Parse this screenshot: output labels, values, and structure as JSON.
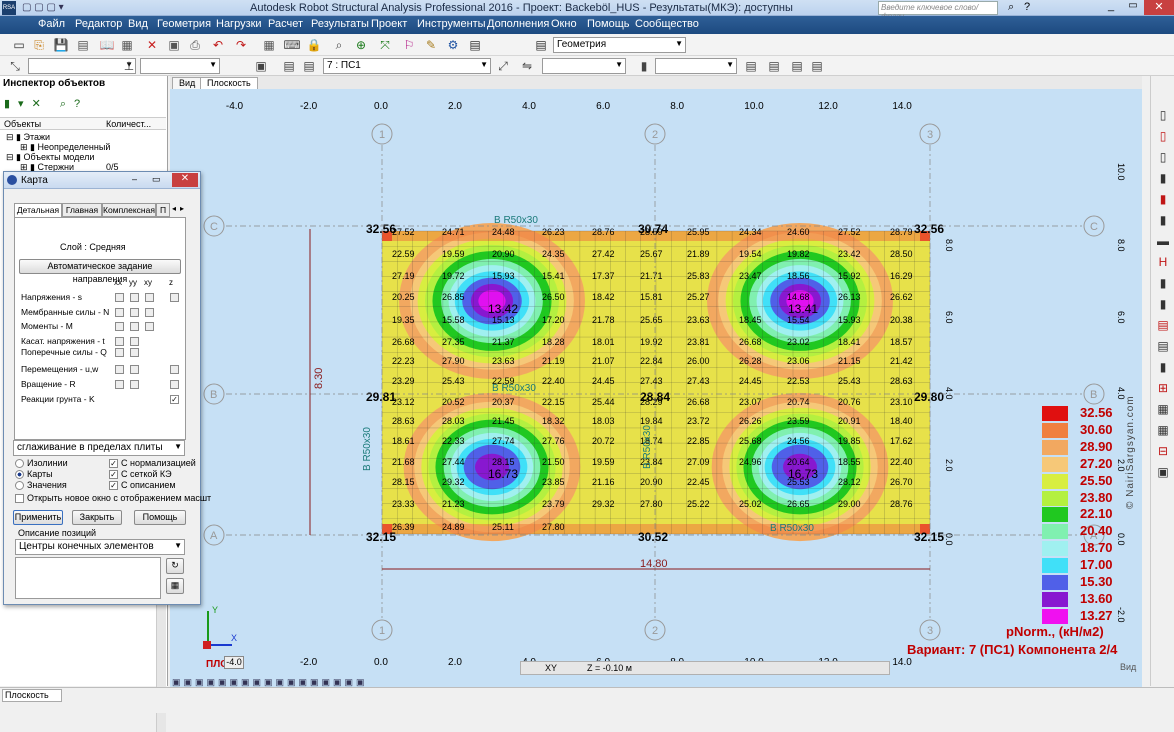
{
  "title_bar": {
    "text": "Autodesk Robot Structural Analysis Professional 2016 - Проект: Backeböl_HUS - Результаты(МКЭ): доступны",
    "search_placeholder": "Введите ключевое слово/фразу"
  },
  "menu": [
    "Файл",
    "Редактор",
    "Вид",
    "Геометрия",
    "Нагрузки",
    "Расчет",
    "Результаты",
    "Проект",
    "Инструменты",
    "Дополнения",
    "Окно",
    "Помощь",
    "Сообщество"
  ],
  "toolbar": {
    "geometry_combo": "Геометрия",
    "case_combo": "7 : ПС1"
  },
  "view_tabs": [
    "Вид",
    "Плоскость"
  ],
  "inspector": {
    "title": "Инспектор объектов",
    "col_objects": "Объекты",
    "col_count": "Количест...",
    "tree": [
      "Этажи",
      "Неопределенный",
      "Объекты модели",
      "Стержни"
    ],
    "tree_count": "0/5"
  },
  "dialog": {
    "title": "Карта",
    "tabs": [
      "Детальная",
      "Главная",
      "Комплексная",
      "П"
    ],
    "layer": "Слой : Средняя",
    "auto_dir_button": "Автоматическое задание направления",
    "cols": [
      "xx",
      "yy",
      "xy",
      "z"
    ],
    "rows": [
      "Напряжения - s",
      "Мембранные силы - N",
      "Моменты - M",
      "Касат. напряжения - t",
      "Поперечные силы - Q",
      "Перемещения - u,w",
      "Вращение - R",
      "Реакции грунта - K"
    ],
    "smoothing": "сглаживание в пределах плиты",
    "radio": [
      "Изолинии",
      "Карты",
      "Значения"
    ],
    "checks": [
      "С нормализацией",
      "С сеткой КЭ",
      "С описанием"
    ],
    "open_new": "Открыть новое окно с отображением масшт",
    "apply": "Применить",
    "close": "Закрыть",
    "help": "Помощь",
    "desc_label": "Описание позиций",
    "desc_combo": "Центры конечных элементов"
  },
  "canvas": {
    "x_ticks": [
      "-4.0",
      "-2.0",
      "0.0",
      "2.0",
      "4.0",
      "6.0",
      "8.0",
      "10.0",
      "12.0",
      "14.0"
    ],
    "x_ticks_bottom": [
      "-2.0",
      "0.0",
      "2.0",
      "4.0",
      "6.0",
      "8.0",
      "10.0",
      "12.0",
      "14.0"
    ],
    "y_ticks": [
      "10.0",
      "8.0",
      "6.0",
      "4.0",
      "2.0",
      "0.0",
      "-2.0"
    ],
    "axis_letters": [
      "C",
      "B",
      "A"
    ],
    "axis_numbers": [
      "1",
      "2",
      "3"
    ],
    "beam_labels": [
      "B R50x30",
      "B R50x30",
      "B R50x30",
      "B R50x30",
      "B R50x30"
    ],
    "dim_vertical": "8.30",
    "dim_horizontal": "14.80",
    "corner_values": [
      "32.56",
      "30.74",
      "32.56",
      "29.81",
      "28.84",
      "29.80",
      "32.15",
      "30.52",
      "32.15"
    ],
    "center_values": [
      "13.42",
      "13.41",
      "16.73",
      "16.73"
    ],
    "grid_labels": [
      "27.52",
      "24.71",
      "24.48",
      "26.23",
      "28.76",
      "28.59",
      "25.95",
      "24.34",
      "24.60",
      "27.52",
      "28.79",
      "22.59",
      "19.59",
      "20.90",
      "24.35",
      "27.42",
      "25.67",
      "21.89",
      "19.54",
      "19.82",
      "23.42",
      "28.50",
      "27.19",
      "19.72",
      "15.93",
      "15.41",
      "17.37",
      "21.71",
      "25.83",
      "23.47",
      "18.56",
      "15.92",
      "16.29",
      "20.25",
      "26.85",
      "26.50",
      "18.42",
      "15.81",
      "25.27",
      "14.68",
      "26.13",
      "26.62",
      "19.35",
      "15.58",
      "15.13",
      "17.20",
      "21.78",
      "25.65",
      "23.63",
      "18.45",
      "15.54",
      "15.93",
      "20.38",
      "26.68",
      "27.35",
      "21.37",
      "18.28",
      "18.01",
      "19.92",
      "23.81",
      "26.68",
      "23.02",
      "18.41",
      "18.57",
      "22.23",
      "27.90",
      "23.63",
      "21.19",
      "21.07",
      "22.84",
      "26.00",
      "26.28",
      "23.06",
      "21.15",
      "21.42",
      "23.29",
      "25.43",
      "22.59",
      "22.40",
      "24.45",
      "27.43",
      "27.43",
      "24.45",
      "22.53",
      "25.43",
      "28.63",
      "23.12",
      "20.52",
      "20.37",
      "22.15",
      "25.44",
      "28.29",
      "26.68",
      "23.07",
      "20.74",
      "20.76",
      "23.10",
      "28.63",
      "28.03",
      "21.45",
      "18.32",
      "18.03",
      "19.84",
      "23.72",
      "26.26",
      "23.59",
      "20.91",
      "18.40",
      "18.61",
      "22.33",
      "27.74",
      "27.76",
      "20.72",
      "18.74",
      "22.85",
      "25.68",
      "24.56",
      "19.85",
      "17.62",
      "21.68",
      "27.44",
      "28.15",
      "21.50",
      "19.59",
      "23.84",
      "27.09",
      "24.96",
      "20.64",
      "18.55",
      "22.40",
      "28.15",
      "29.32",
      "23.85",
      "21.16",
      "20.90",
      "22.45",
      "25.53",
      "28.12",
      "26.70",
      "23.33",
      "21.23",
      "23.79",
      "29.32",
      "27.80",
      "25.22",
      "25.02",
      "26.65",
      "29.00",
      "28.76",
      "26.39",
      "24.89",
      "25.11",
      "27.80"
    ],
    "legend_values": [
      "32.56",
      "30.60",
      "28.90",
      "27.20",
      "25.50",
      "23.80",
      "22.10",
      "20.40",
      "18.70",
      "17.00",
      "15.30",
      "13.60",
      "13.27"
    ],
    "legend_colors": [
      "#e01010",
      "#f08040",
      "#f2a860",
      "#f6c878",
      "#d8ee40",
      "#b4f040",
      "#20c820",
      "#80f0b0",
      "#a0f0f0",
      "#40e0f8",
      "#5060e8",
      "#8818d0",
      "#f010f0"
    ],
    "legend_unit": "pNorm., (кН/м2)",
    "variant": "Вариант: 7 (ПС1) Компонента 2/4",
    "plane_label": "ПЛОСК.",
    "plane_value": "-4.0",
    "status_xy": "XY",
    "status_z": "Z = -0.10 м",
    "view_label": "Вид",
    "watermark": "© NairiSargsyan.com"
  },
  "bottom": {
    "tab": "Плоскость"
  }
}
